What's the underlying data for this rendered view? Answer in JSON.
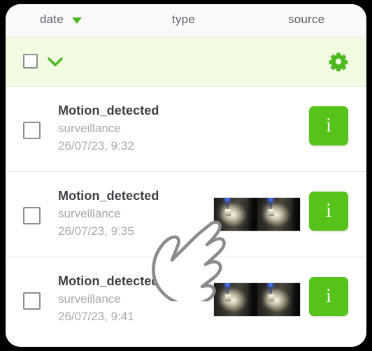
{
  "columns": {
    "date": "date",
    "type": "type",
    "source": "source",
    "sort_icon": "sort-descending-caret",
    "sort_direction": "descending",
    "sort_color": "#4cb820"
  },
  "toolbar": {
    "select_all_icon": "checkbox-unchecked",
    "select_all_checked": false,
    "bulk_menu_icon": "chevron-down-icon",
    "settings_icon": "gear-icon",
    "background_color": "#f0fbe2",
    "accent_color": "#56c31a"
  },
  "events": [
    {
      "checkbox_icon": "checkbox-unchecked",
      "checked": false,
      "title": "Motion_detected",
      "source": "surveillance",
      "timestamp": "26/07/23, 9:32",
      "has_thumbnail": false,
      "info_label": "i"
    },
    {
      "checkbox_icon": "checkbox-unchecked",
      "checked": false,
      "title": "Motion_detected",
      "source": "surveillance",
      "timestamp": "26/07/23, 9:35",
      "has_thumbnail": true,
      "info_label": "i"
    },
    {
      "checkbox_icon": "checkbox-unchecked",
      "checked": false,
      "title": "Motion_detected",
      "source": "surveillance",
      "timestamp": "26/07/23, 9:41",
      "has_thumbnail": true,
      "info_label": "i"
    }
  ],
  "cursor": {
    "icon": "pointing-hand-cursor",
    "stroke_color": "#8a8a8a"
  },
  "colors": {
    "frame": "#000000",
    "header_background": "#fafafa",
    "header_text": "#5a6068",
    "row_title": "#3b3f44",
    "row_meta": "#a5a9ad",
    "divider": "#e9e9e9",
    "info_button": "#56c31a"
  }
}
